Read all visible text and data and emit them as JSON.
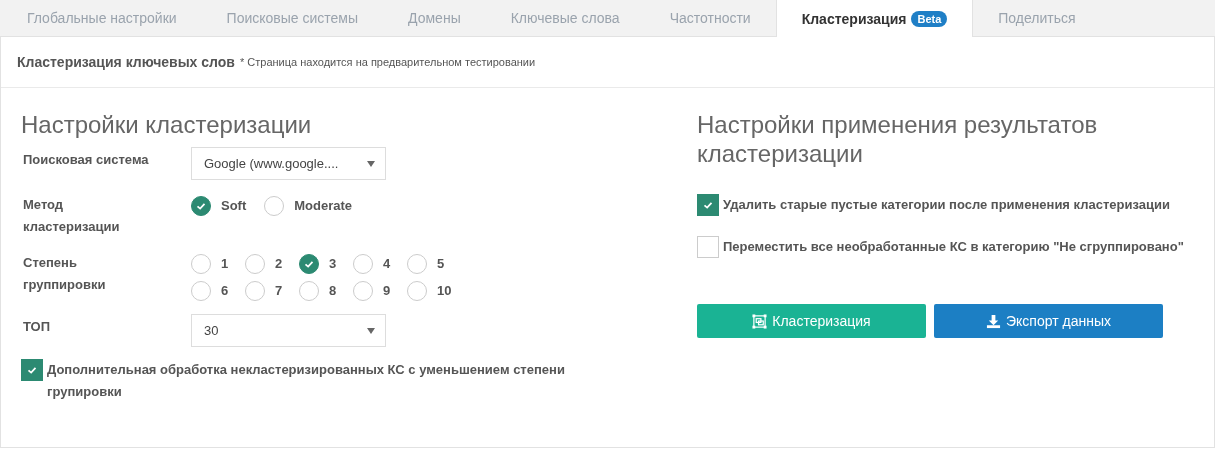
{
  "tabs": [
    {
      "label": "Глобальные настройки",
      "selected": false
    },
    {
      "label": "Поисковые системы",
      "selected": false
    },
    {
      "label": "Домены",
      "selected": false
    },
    {
      "label": "Ключевые слова",
      "selected": false
    },
    {
      "label": "Частотности",
      "selected": false
    },
    {
      "label": "Кластеризация",
      "selected": true,
      "badge": "Beta"
    },
    {
      "label": "Поделиться",
      "selected": false
    }
  ],
  "header": {
    "title": "Кластеризация ключевых слов",
    "note": "* Страница находится на предварительном тестировании"
  },
  "clustering_settings": {
    "title": "Настройки кластеризации",
    "fields": [
      {
        "kind": "select",
        "label": "Поисковая система",
        "value": "Google (www.google...."
      },
      {
        "kind": "radio",
        "label": "Метод кластеризации",
        "options": [
          {
            "label": "Soft",
            "selected": true
          },
          {
            "label": "Moderate",
            "selected": false
          }
        ]
      },
      {
        "kind": "radiogrid",
        "label": "Степень группировки",
        "options": [
          {
            "label": "1",
            "selected": false
          },
          {
            "label": "2",
            "selected": false
          },
          {
            "label": "3",
            "selected": true
          },
          {
            "label": "4",
            "selected": false
          },
          {
            "label": "5",
            "selected": false
          },
          {
            "label": "6",
            "selected": false
          },
          {
            "label": "7",
            "selected": false
          },
          {
            "label": "8",
            "selected": false
          },
          {
            "label": "9",
            "selected": false
          },
          {
            "label": "10",
            "selected": false
          }
        ]
      },
      {
        "kind": "select",
        "label": "ТОП",
        "value": "30"
      }
    ],
    "extra_option": {
      "label": "Дополнительная обработка некластеризированных КС с уменьшением степени групировки",
      "checked": true
    }
  },
  "apply_settings": {
    "title": "Настройки применения результатов кластеризации",
    "options": [
      {
        "label": "Удалить старые пустые категории после применения кластеризации",
        "checked": true
      },
      {
        "label": "Переместить все необработанные КС в категорию \"Не сгруппировано\"",
        "checked": false
      }
    ],
    "buttons": [
      {
        "kind": "cluster",
        "label": "Кластеризация"
      },
      {
        "kind": "export",
        "label": "Экспорт данных"
      }
    ]
  }
}
